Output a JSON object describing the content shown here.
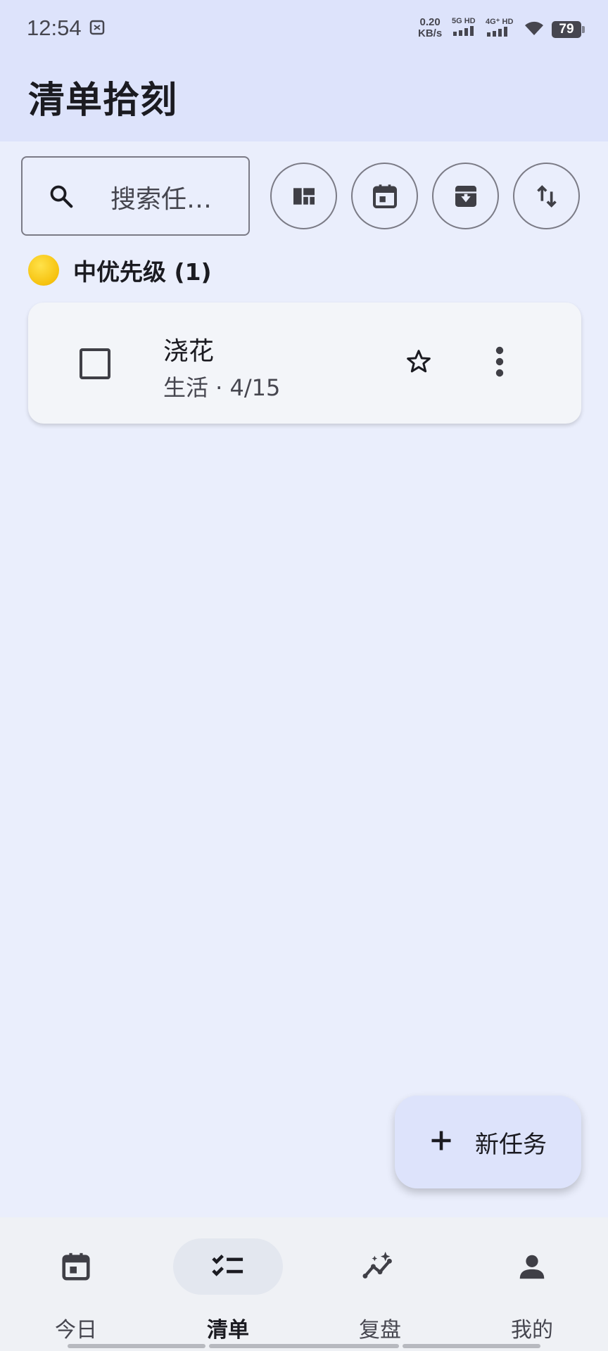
{
  "status": {
    "time": "12:54",
    "speed_value": "0.20",
    "speed_unit": "KB/s",
    "sim1_label": "5G HD",
    "sim2_label": "4G⁺ HD",
    "battery": "79"
  },
  "header": {
    "title": "清单拾刻"
  },
  "toolbar": {
    "search_placeholder": "搜索任…",
    "buttons": [
      "view-layout-icon",
      "calendar-icon",
      "archive-icon",
      "sort-icon"
    ]
  },
  "group": {
    "title": "中优先级 (1)",
    "color": "#f6c20e"
  },
  "tasks": [
    {
      "title": "浇花",
      "meta": "生活 · 4/15",
      "starred": false,
      "done": false
    }
  ],
  "fab": {
    "label": "新任务"
  },
  "nav": {
    "items": [
      {
        "label": "今日",
        "icon": "calendar-today-icon"
      },
      {
        "label": "清单",
        "icon": "checklist-icon"
      },
      {
        "label": "复盘",
        "icon": "insights-icon"
      },
      {
        "label": "我的",
        "icon": "person-icon"
      }
    ],
    "active_index": 1
  },
  "colors": {
    "header_bg": "#dde3fb",
    "body_bg": "#eaeefc",
    "card_bg": "#f3f5f9",
    "nav_bg": "#eff1f5"
  }
}
